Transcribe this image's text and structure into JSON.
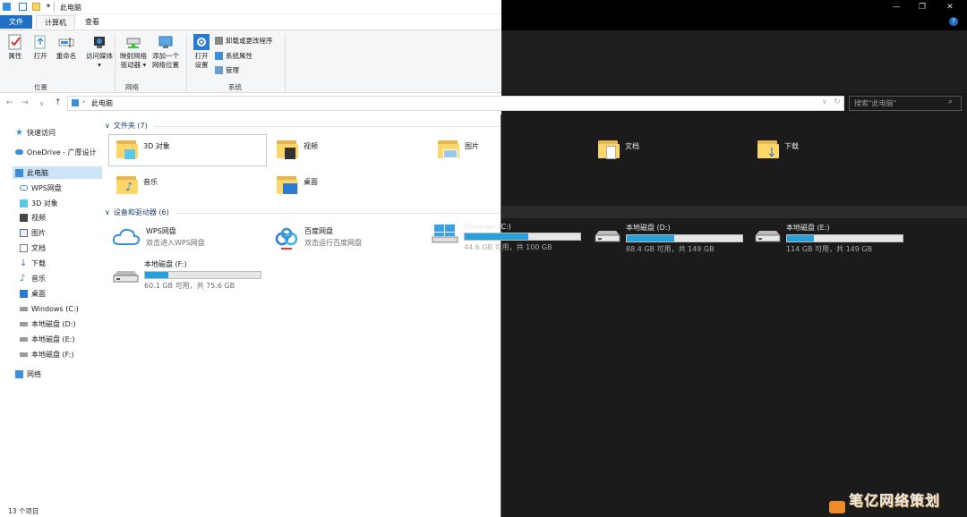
{
  "window": {
    "title": "此电脑",
    "controls": {
      "minimize": "—",
      "maximize": "❐",
      "close": "✕"
    }
  },
  "tabs": [
    {
      "label": "文件",
      "active": true
    },
    {
      "label": "计算机",
      "active": false
    },
    {
      "label": "查看",
      "active": false
    }
  ],
  "ribbon": {
    "location_group": {
      "label": "位置",
      "buttons": [
        {
          "line1": "属性",
          "line2": ""
        },
        {
          "line1": "打开",
          "line2": ""
        },
        {
          "line1": "重命名",
          "line2": ""
        },
        {
          "line1": "访问媒体",
          "line2": "▾"
        }
      ]
    },
    "network_group": {
      "label": "网络",
      "buttons": [
        {
          "line1": "映射网络",
          "line2": "驱动器 ▾"
        },
        {
          "line1": "添加一个",
          "line2": "网络位置"
        }
      ]
    },
    "system_group": {
      "label": "系统",
      "open_settings": {
        "line1": "打开",
        "line2": "设置"
      },
      "items": [
        "卸载或更改程序",
        "系统属性",
        "管理"
      ]
    }
  },
  "addressbar": {
    "path_root": "此电脑",
    "search_placeholder": "搜索\"此电脑\""
  },
  "sidebar": {
    "items": [
      {
        "label": "快速访问",
        "icon": "star-icon"
      },
      {
        "label": "OneDrive - 广厚设计",
        "icon": "cloud-icon"
      },
      {
        "label": "此电脑",
        "icon": "computer-icon",
        "selected": true
      },
      {
        "label": "WPS网盘",
        "icon": "wps-cloud-icon"
      },
      {
        "label": "3D 对象",
        "icon": "3d-icon"
      },
      {
        "label": "视频",
        "icon": "video-icon"
      },
      {
        "label": "图片",
        "icon": "picture-icon"
      },
      {
        "label": "文档",
        "icon": "document-icon"
      },
      {
        "label": "下载",
        "icon": "download-icon"
      },
      {
        "label": "音乐",
        "icon": "music-icon"
      },
      {
        "label": "桌面",
        "icon": "desktop-icon"
      },
      {
        "label": "Windows (C:)",
        "icon": "drive-c-icon"
      },
      {
        "label": "本地磁盘 (D:)",
        "icon": "drive-icon"
      },
      {
        "label": "本地磁盘 (E:)",
        "icon": "drive-icon"
      },
      {
        "label": "本地磁盘 (F:)",
        "icon": "drive-icon"
      },
      {
        "label": "网络",
        "icon": "network-icon"
      }
    ]
  },
  "folders_section": {
    "header": "文件夹 (7)",
    "items": [
      {
        "label": "3D 对象"
      },
      {
        "label": "视频"
      },
      {
        "label": "图片"
      },
      {
        "label": "文档"
      },
      {
        "label": "下载"
      },
      {
        "label": "音乐"
      },
      {
        "label": "桌面"
      }
    ]
  },
  "devices_section": {
    "header": "设备和驱动器 (6)",
    "cloud": [
      {
        "name": "WPS网盘",
        "sub": "双击进入WPS网盘"
      },
      {
        "name": "百度网盘",
        "sub": "双击运行百度网盘"
      }
    ],
    "drives": [
      {
        "name": "Windows (C:)",
        "usage": "44.6 GB 可用，共 100 GB",
        "fill": 0.55
      },
      {
        "name": "本地磁盘 (D:)",
        "usage": "88.4 GB 可用，共 149 GB",
        "fill": 0.41
      },
      {
        "name": "本地磁盘 (E:)",
        "usage": "114 GB 可用，共 149 GB",
        "fill": 0.23
      },
      {
        "name": "本地磁盘 (F:)",
        "usage": "60.1 GB 可用，共 75.6 GB",
        "fill": 0.2
      }
    ]
  },
  "status": {
    "text": "13 个项目"
  },
  "watermark": {
    "text": "笔亿网络策划"
  },
  "colors": {
    "accent": "#1f6fc4",
    "folder": "#ffd667",
    "drive_fill": "#26a0da",
    "dark_bg": "#1b1b1b"
  }
}
